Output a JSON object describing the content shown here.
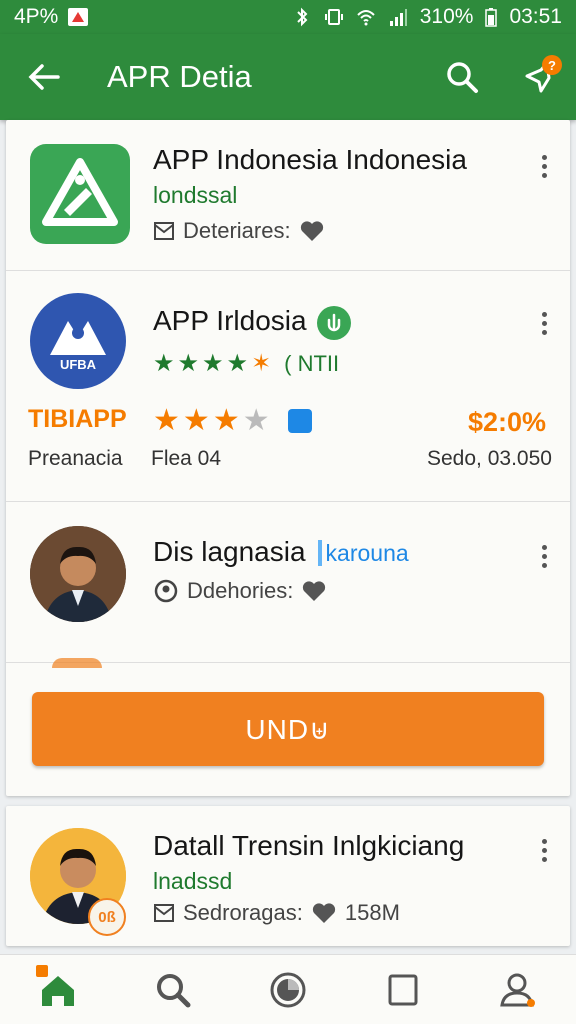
{
  "status_bar": {
    "left_text": "4P%",
    "battery": "310%",
    "time": "03:51"
  },
  "app_bar": {
    "title": "APR Detia",
    "notification_badge": "?"
  },
  "items": [
    {
      "title": "APP Indonesia Indonesia",
      "subtitle": "londssal",
      "meta_label": "Deteriares:",
      "thumb_color": "#3aa655"
    },
    {
      "title": "APP Irldosia",
      "logo_text": "UFBA",
      "rating_label": "( NTII",
      "brand_label": "TIBIAPP",
      "price": "$2:0%",
      "left_caption": "Preanacia",
      "mid_caption": "Flea 04",
      "right_caption": "Sedo, 03.050",
      "rating": 4.5,
      "secondary_rating": 3.5
    },
    {
      "title": "Dis lagnasia",
      "tag": "karouna",
      "meta_label": "Ddehories:"
    },
    {
      "title": "Datall Trensin Inlgkiciang",
      "subtitle": "lnadssd",
      "meta_label": "Sedroragas:",
      "meta_value": "158M",
      "avatar_badge": "0ß"
    }
  ],
  "cta": {
    "label": "UND⊎"
  },
  "colors": {
    "primary_green": "#2e8b3c",
    "accent_orange": "#f08020",
    "link_blue": "#1e88e5"
  },
  "bottom_nav": [
    "home-icon",
    "search-icon",
    "circle-icon",
    "square-icon",
    "profile-icon"
  ]
}
